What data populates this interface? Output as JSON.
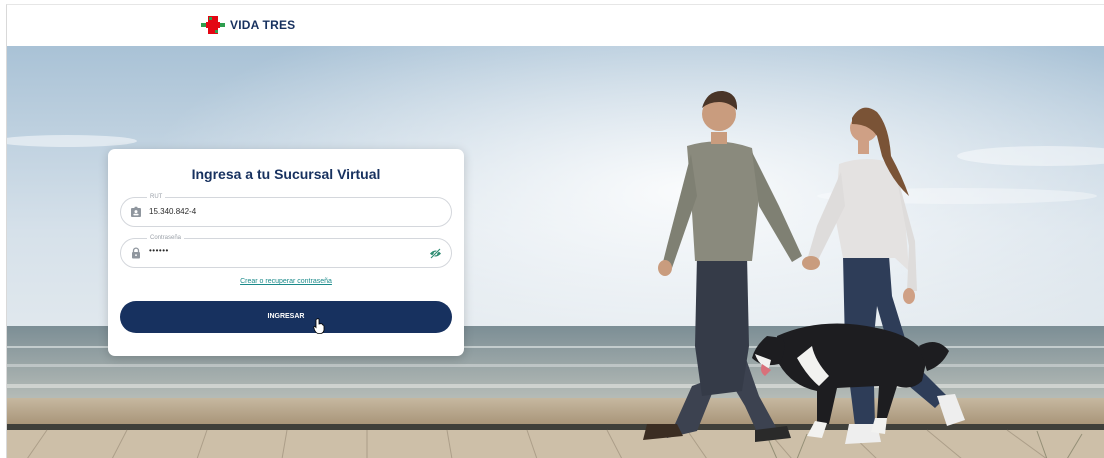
{
  "brand": {
    "name": "VIDA TRES",
    "colors": {
      "navy": "#17315f",
      "red": "#e30613",
      "green": "#2e9e4f",
      "teal": "#1b8a8a"
    }
  },
  "login": {
    "title": "Ingresa a tu Sucursal Virtual",
    "rut": {
      "label": "RUT",
      "value": "15.340.842-4",
      "icon": "id-card-icon"
    },
    "password": {
      "label": "Contraseña",
      "value": "••••••",
      "icon": "lock-icon",
      "toggle_icon": "eye-slash-icon"
    },
    "recover_link": "Crear o recuperar contraseña",
    "submit_label": "INGRESAR"
  },
  "hero": {
    "image": "couple-walking-dog-on-boardwalk-by-the-sea"
  }
}
